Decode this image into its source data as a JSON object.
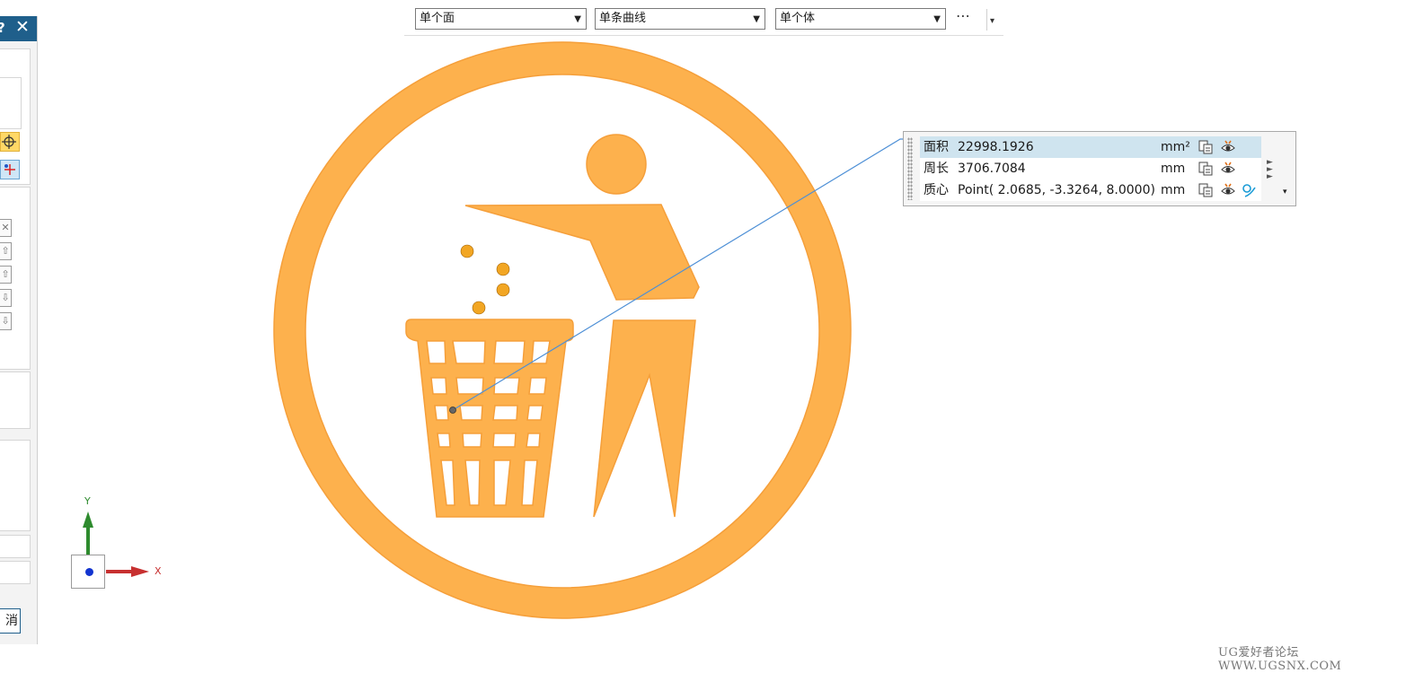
{
  "dialog": {
    "help_glyph": "?",
    "close_glyph": "✕",
    "list_buttons": [
      "✕",
      "⇧",
      "⇧",
      "⇩",
      "⇩"
    ],
    "cancel_label": "消"
  },
  "selection_bar": {
    "face_filter": "单个面",
    "curve_filter": "单条曲线",
    "body_filter": "单个体",
    "more_glyph": "⋯",
    "dropdown_glyph": "▾",
    "arrow_glyph": "▼"
  },
  "measurement": {
    "rows": [
      {
        "label": "面积",
        "value": "22998.1926",
        "unit": "mm²"
      },
      {
        "label": "周长",
        "value": "3706.7084",
        "unit": "mm"
      },
      {
        "label": "质心",
        "value": "Point( 2.0685, -3.3264, 8.0000)",
        "unit": "mm"
      }
    ],
    "side_arrows": "►\n►\n►",
    "side_dropdown": "▾"
  },
  "triad": {
    "x_label": "X",
    "y_label": "Y"
  },
  "watermark": "UG爱好者论坛 WWW.UGSNX.COM",
  "colors": {
    "sign_fill": "#fdb14d",
    "sign_stroke": "#f59f3a",
    "particle": "#f2a623",
    "leader_line": "#4d8fd6",
    "selected_row": "#cfe4ef",
    "dialog_title": "#1f5f8b",
    "y_axis": "#2e8b2e",
    "x_axis": "#c73030"
  },
  "icons": [
    "help-icon",
    "close-icon",
    "crosshair-icon",
    "point-icon",
    "copy-icon",
    "eye-icon",
    "curve-icon",
    "grip-icon"
  ]
}
